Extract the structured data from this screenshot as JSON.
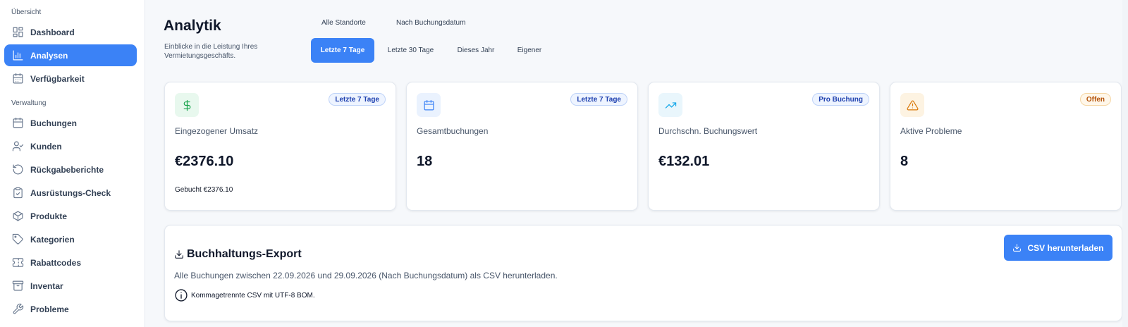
{
  "sidebar": {
    "section_overview": "Übersicht",
    "section_management": "Verwaltung",
    "items": [
      {
        "label": "Dashboard",
        "icon": "dashboard-icon"
      },
      {
        "label": "Analysen",
        "icon": "chart-bar-icon",
        "active": true
      },
      {
        "label": "Verfügbarkeit",
        "icon": "calendar-grid-icon"
      },
      {
        "label": "Buchungen",
        "icon": "calendar-icon"
      },
      {
        "label": "Kunden",
        "icon": "user-check-icon"
      },
      {
        "label": "Rückgabeberichte",
        "icon": "rotate-ccw-icon"
      },
      {
        "label": "Ausrüstungs-Check",
        "icon": "clipboard-check-icon"
      },
      {
        "label": "Produkte",
        "icon": "box-icon"
      },
      {
        "label": "Kategorien",
        "icon": "tag-icon"
      },
      {
        "label": "Rabattcodes",
        "icon": "ticket-icon"
      },
      {
        "label": "Inventar",
        "icon": "archive-icon"
      },
      {
        "label": "Probleme",
        "icon": "wrench-icon"
      }
    ]
  },
  "header": {
    "title": "Analytik",
    "subtitle": "Einblicke in die Leistung Ihres Vermietungsgeschäfts."
  },
  "filters": {
    "location": "Alle Standorte",
    "date_mode": "Nach Buchungsdatum",
    "ranges": [
      "Letzte 7 Tage",
      "Letzte 30 Tage",
      "Dieses Jahr",
      "Eigener"
    ],
    "active_range": "Letzte 7 Tage"
  },
  "cards": [
    {
      "label": "Eingezogener Umsatz",
      "value": "€2376.10",
      "badge": "Letzte 7 Tage",
      "note": "Gebucht €2376.10",
      "icon": "dollar-icon"
    },
    {
      "label": "Gesamtbuchungen",
      "value": "18",
      "badge": "Letzte 7 Tage",
      "icon": "calendar-icon"
    },
    {
      "label": "Durchschn. Buchungswert",
      "value": "€132.01",
      "badge": "Pro Buchung",
      "icon": "trending-up-icon"
    },
    {
      "label": "Aktive Probleme",
      "value": "8",
      "badge": "Offen",
      "icon": "warning-icon"
    }
  ],
  "export": {
    "title": "Buchhaltungs-Export",
    "description": "Alle Buchungen zwischen 22.09.2026 und 29.09.2026 (Nach Buchungsdatum) als CSV herunterladen.",
    "note": "Kommagetrennte CSV mit UTF-8 BOM.",
    "button": "CSV herunterladen"
  },
  "colors": {
    "accent": "#3b82f6",
    "green": "#16a34a",
    "orange": "#d97706"
  }
}
